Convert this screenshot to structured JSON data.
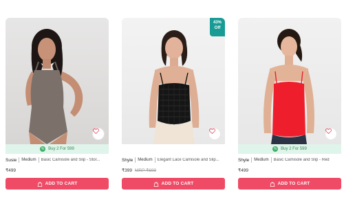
{
  "products": [
    {
      "brand": "Susie",
      "size": "Medium",
      "name": "Basic Camisole and Slip - Stor...",
      "price": "₹499",
      "mrp": "",
      "offer": "Buy 2 For 599",
      "badge_line1": "",
      "badge_line2": "",
      "cart_label": "ADD TO CART"
    },
    {
      "brand": "Shyle",
      "size": "Medium",
      "name": "Elegant Lace Camisole and Slip...",
      "price": "₹399",
      "mrp": "MRP ₹699",
      "offer": "",
      "badge_line1": "43%",
      "badge_line2": "Off",
      "cart_label": "ADD TO CART"
    },
    {
      "brand": "Shyle",
      "size": "Medium",
      "name": "Basic Camisole and Slip - Red",
      "price": "₹499",
      "mrp": "",
      "offer": "Buy 2 For 599",
      "badge_line1": "",
      "badge_line2": "",
      "cart_label": "ADD TO CART"
    }
  ],
  "colors": {
    "cart_button": "#ef4b66",
    "offer_bg": "#dff4ea",
    "offer_text": "#2f8a50",
    "discount_badge": "#179c95"
  },
  "icons": {
    "wishlist": "heart-icon",
    "cart": "bag-icon",
    "offer": "offer-icon"
  }
}
